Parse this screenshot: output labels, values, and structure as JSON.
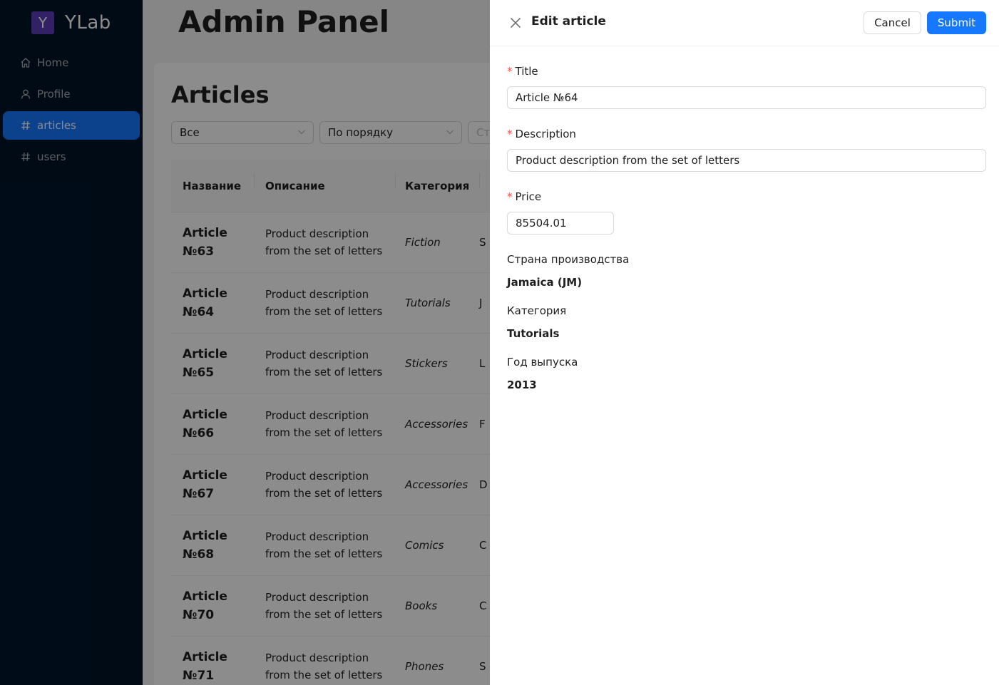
{
  "sidebar": {
    "logo_letter": "Y",
    "logo_text": "YLab",
    "items": [
      {
        "label": "Home",
        "icon": "home-icon"
      },
      {
        "label": "Profile",
        "icon": "user-icon"
      },
      {
        "label": "articles",
        "icon": "hash-icon",
        "active": true
      },
      {
        "label": "users",
        "icon": "hash-icon"
      }
    ]
  },
  "main": {
    "title": "Admin Panel",
    "section_title": "Articles",
    "filters": [
      {
        "value": "Все"
      },
      {
        "value": "По порядку"
      },
      {
        "value": "Ст"
      }
    ],
    "table": {
      "headers": [
        "Название",
        "Описание",
        "Категория",
        "С"
      ],
      "rows": [
        {
          "name": [
            "Article",
            "№63"
          ],
          "desc": [
            "Product description",
            "from the set of letters"
          ],
          "category": "Fiction",
          "extra": "S"
        },
        {
          "name": [
            "Article",
            "№64"
          ],
          "desc": [
            "Product description",
            "from the set of letters"
          ],
          "category": "Tutorials",
          "extra": "J"
        },
        {
          "name": [
            "Article",
            "№65"
          ],
          "desc": [
            "Product description",
            "from the set of letters"
          ],
          "category": "Stickers",
          "extra": "L"
        },
        {
          "name": [
            "Article",
            "№66"
          ],
          "desc": [
            "Product description",
            "from the set of letters"
          ],
          "category": "Accessories",
          "extra": "F"
        },
        {
          "name": [
            "Article",
            "№67"
          ],
          "desc": [
            "Product description",
            "from the set of letters"
          ],
          "category": "Accessories",
          "extra": "D"
        },
        {
          "name": [
            "Article",
            "№68"
          ],
          "desc": [
            "Product description",
            "from the set of letters"
          ],
          "category": "Comics",
          "extra": "C"
        },
        {
          "name": [
            "Article",
            "№70"
          ],
          "desc": [
            "Product description",
            "from the set of letters"
          ],
          "category": "Books",
          "extra": "C"
        },
        {
          "name": [
            "Article",
            "№71"
          ],
          "desc": [
            "Product description",
            "from the set of letters"
          ],
          "category": "Phones",
          "extra": "S"
        }
      ]
    }
  },
  "drawer": {
    "title": "Edit article",
    "cancel_label": "Cancel",
    "submit_label": "Submit",
    "fields": {
      "title_label": "Title",
      "title_value": "Article №64",
      "description_label": "Description",
      "description_value": "Product description from the set of letters",
      "price_label": "Price",
      "price_value": "85504.01"
    },
    "info": {
      "country_label": "Страна производства",
      "country_value": "Jamaica (JM)",
      "category_label": "Категория",
      "category_value": "Tutorials",
      "year_label": "Год выпуска",
      "year_value": "2013"
    }
  },
  "colors": {
    "primary": "#1677ff",
    "sidebar_bg": "#001529",
    "logo_bg": "#5b3fb8",
    "required": "#ff4d4f"
  }
}
